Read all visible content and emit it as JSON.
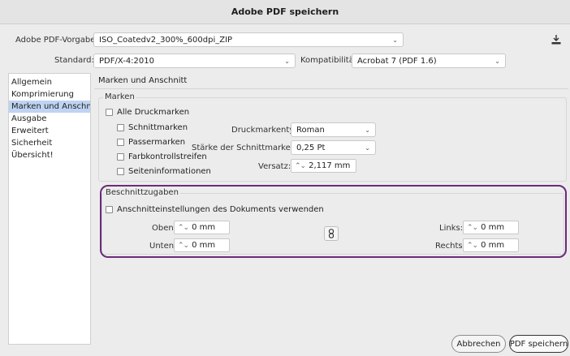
{
  "window": {
    "title": "Adobe PDF speichern"
  },
  "preset": {
    "label": "Adobe PDF-Vorgabe:",
    "value": "ISO_Coatedv2_300%_600dpi_ZIP"
  },
  "standard": {
    "label": "Standard:",
    "value": "PDF/X-4:2010"
  },
  "compat": {
    "label": "Kompatibilität:",
    "value": "Acrobat 7 (PDF 1.6)"
  },
  "sidebar": {
    "items": [
      {
        "label": "Allgemein"
      },
      {
        "label": "Komprimierung"
      },
      {
        "label": "Marken und Anschnitt"
      },
      {
        "label": "Ausgabe"
      },
      {
        "label": "Erweitert"
      },
      {
        "label": "Sicherheit"
      },
      {
        "label": "Übersicht!"
      }
    ]
  },
  "panel": {
    "title": "Marken und Anschnitt"
  },
  "marks": {
    "group_title": "Marken",
    "all_marks": "Alle Druckmarken",
    "crop": "Schnittmarken",
    "registration": "Passermarken",
    "color_bars": "Farbkontrollstreifen",
    "page_info": "Seiteninformationen",
    "type_label": "Druckmarkentyp:",
    "type_value": "Roman",
    "weight_label": "Stärke der Schnittmarke:",
    "weight_value": "0,25 Pt",
    "offset_label": "Versatz:",
    "offset_value": "2,117 mm"
  },
  "bleed": {
    "group_title": "Beschnittzugaben",
    "use_doc": "Anschnitteinstellungen des Dokuments verwenden",
    "top_label": "Oben:",
    "top_value": "0 mm",
    "bottom_label": "Unten:",
    "bottom_value": "0 mm",
    "left_label": "Links:",
    "left_value": "0 mm",
    "right_label": "Rechts:",
    "right_value": "0 mm"
  },
  "buttons": {
    "cancel": "Abbrechen",
    "save": "PDF speichern"
  },
  "colors": {
    "sidebar_selected": "#bfd4f2",
    "highlight_border": "#6b2a7a"
  }
}
